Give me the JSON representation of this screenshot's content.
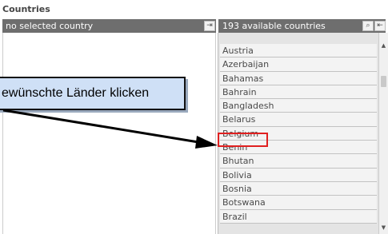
{
  "section_title": "Countries",
  "left_panel": {
    "header": "no selected country",
    "header_button_icon": "move-all-left-icon"
  },
  "right_panel": {
    "header": "193 available countries",
    "search_icon": "search-icon",
    "add_all_icon": "move-all-right-icon",
    "countries": [
      "Austria",
      "Azerbaijan",
      "Bahamas",
      "Bahrain",
      "Bangladesh",
      "Belarus",
      "Belgium",
      "Benin",
      "Bhutan",
      "Bolivia",
      "Bosnia",
      "Botswana",
      "Brazil"
    ],
    "highlighted_country": "Belgium"
  },
  "callout": {
    "text": "ewünschte Länder klicken"
  },
  "colors": {
    "header_bg": "#6e6e6e",
    "highlight": "#e02020",
    "callout_bg": "#cfe0f6"
  }
}
